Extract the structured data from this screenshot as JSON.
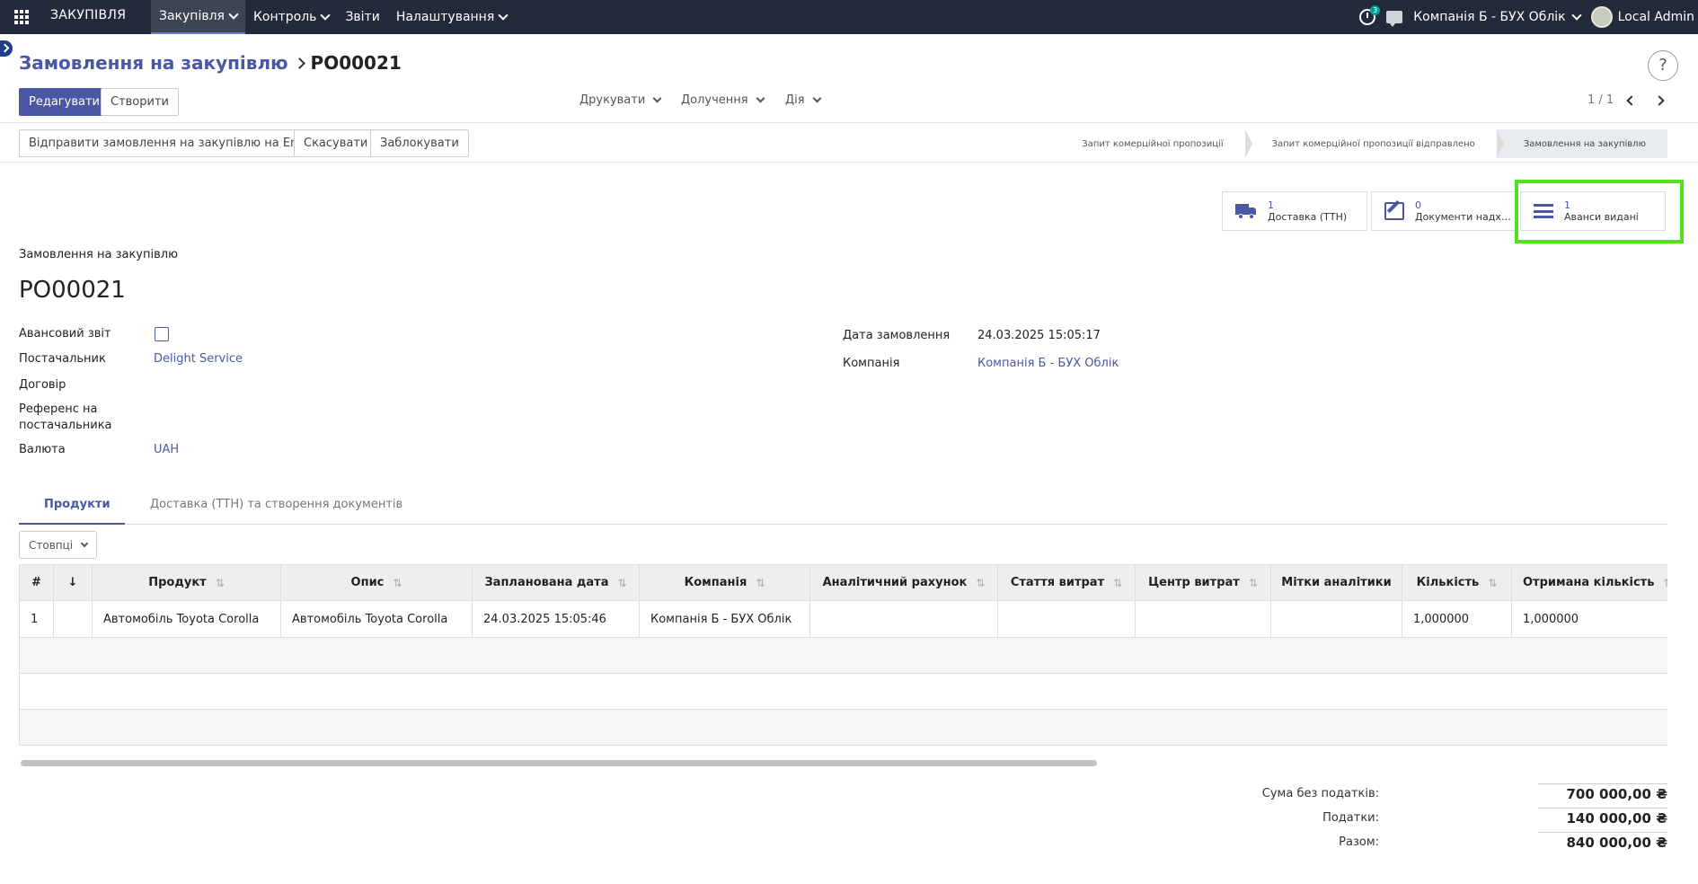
{
  "topbar": {
    "brand": "ЗАКУПІВЛЯ",
    "menu": [
      {
        "label": "Закупівля"
      },
      {
        "label": "Контроль"
      },
      {
        "label": "Звіти"
      },
      {
        "label": "Налаштування"
      }
    ],
    "activity_count": "3",
    "company": "Компанія Б - БУХ Облік",
    "user": "Local Admin"
  },
  "breadcrumb": {
    "parent": "Замовлення на закупівлю",
    "current": "PO00021"
  },
  "actions": {
    "edit": "Редагувати",
    "create": "Створити",
    "print": "Друкувати",
    "attachments": "Долучення",
    "action": "Дія",
    "pager": "1 / 1"
  },
  "header_buttons": {
    "send_email": "Відправити замовлення на закупівлю на Email",
    "cancel": "Скасувати",
    "lock": "Заблокувати"
  },
  "statusbar": [
    {
      "label": "Запит комерційної пропозиції"
    },
    {
      "label": "Запит комерційної пропозиції відправлено"
    },
    {
      "label": "Замовлення на закупівлю"
    }
  ],
  "smart_buttons": [
    {
      "value": "1",
      "label": "Доставка (ТТН)",
      "icon": "truck-icon"
    },
    {
      "value": "0",
      "label": "Документи надходження",
      "icon": "edit-icon"
    },
    {
      "value": "1",
      "label": "Аванси видані",
      "icon": "bars-icon"
    }
  ],
  "form": {
    "type_label": "Замовлення на закупівлю",
    "name": "PO00021",
    "fields_left": [
      {
        "label": "Авансовий звіт",
        "value": ""
      },
      {
        "label": "Постачальник",
        "value": "Delight Service"
      },
      {
        "label": "Договір",
        "value": ""
      },
      {
        "label": "Референс на постачальника",
        "value": ""
      },
      {
        "label": "Валюта",
        "value": "UAH"
      }
    ],
    "fields_right": [
      {
        "label": "Дата замовлення",
        "value": "24.03.2025 15:05:17"
      },
      {
        "label": "Компанія",
        "value": "Компанія Б - БУХ Облік"
      }
    ]
  },
  "tabs": [
    {
      "label": "Продукти"
    },
    {
      "label": "Доставка (ТТН) та створення документів"
    }
  ],
  "columns_button": "Стовпці",
  "table": {
    "headers": [
      "#",
      "↓",
      "Продукт",
      "Опис",
      "Запланована дата",
      "Компанія",
      "Аналітичний рахунок",
      "Стаття витрат",
      "Центр витрат",
      "Мітки аналітики",
      "Кількість",
      "Отримана кількість"
    ],
    "rows": [
      [
        "1",
        "",
        "Автомобіль Toyota Corolla",
        "Автомобіль Toyota Corolla",
        "24.03.2025 15:05:46",
        "Компанія Б - БУХ Облік",
        "",
        "",
        "",
        "",
        "1,000000",
        "1,000000"
      ]
    ]
  },
  "totals": {
    "untaxed_label": "Сума без податків:",
    "untaxed_value": "700 000,00 ₴",
    "tax_label": "Податки:",
    "tax_value": "140 000,00 ₴",
    "total_label": "Разом:",
    "total_value": "840 000,00 ₴"
  }
}
